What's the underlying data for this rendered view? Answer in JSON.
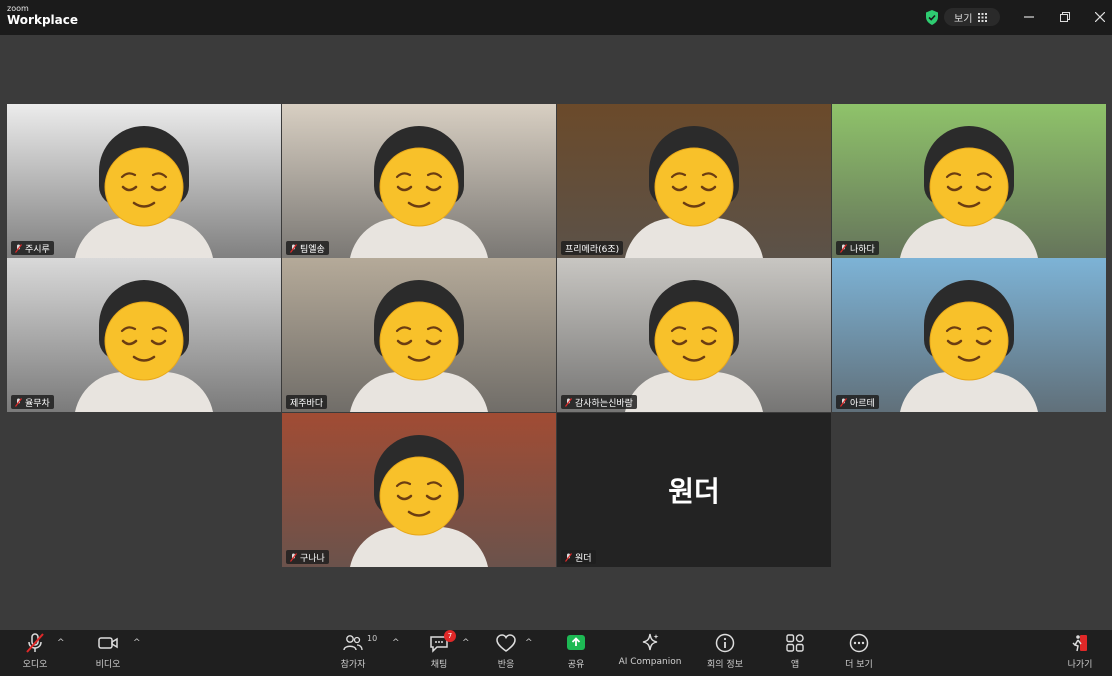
{
  "window": {
    "logo_small": "zoom",
    "logo_large": "Workplace",
    "view_label": "보기"
  },
  "participants": [
    {
      "name": "주시루",
      "muted": true,
      "bg": "#ececec"
    },
    {
      "name": "팀엘송",
      "muted": true,
      "bg": "#d8cfc2"
    },
    {
      "name": "프리메라(6조)",
      "muted": false,
      "bg": "#6b4a2a"
    },
    {
      "name": "나하다",
      "muted": true,
      "bg": "#8fc36a"
    },
    {
      "name": "율무차",
      "muted": true,
      "bg": "#d9d9d9"
    },
    {
      "name": "제주바다",
      "muted": false,
      "bg": "#b5aa99",
      "active": true
    },
    {
      "name": "감사하는신바람",
      "muted": true,
      "bg": "#c8c6c2"
    },
    {
      "name": "아르테",
      "muted": true,
      "bg": "#7db3d6"
    },
    {
      "name": "구나나",
      "muted": true,
      "bg": "#a14c34"
    },
    {
      "name": "원더",
      "muted": true,
      "bg": "#232323",
      "video_off": true
    }
  ],
  "toolbar": {
    "audio": "오디오",
    "video": "비디오",
    "participants": "참가자",
    "participants_count": "10",
    "chat": "채팅",
    "chat_badge": "7",
    "reactions": "반응",
    "share": "공유",
    "ai_companion": "AI Companion",
    "meeting_info": "회의 정보",
    "apps": "앱",
    "more": "더 보기",
    "leave": "나가기"
  },
  "colors": {
    "active_speaker": "#2ecc71",
    "share_green": "#1db954",
    "leave_red": "#e02828"
  }
}
